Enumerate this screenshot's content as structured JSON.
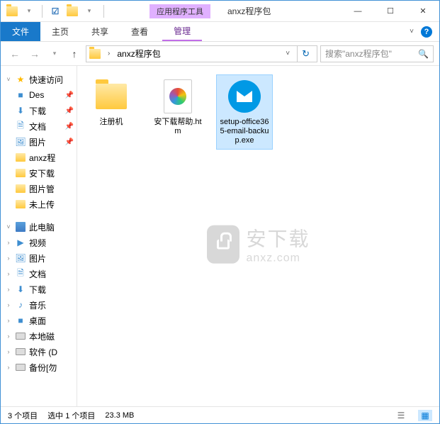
{
  "titlebar": {
    "context_label": "应用程序工具",
    "title": "anxz程序包"
  },
  "window_controls": {
    "min": "—",
    "max": "☐",
    "close": "✕"
  },
  "ribbon": {
    "file": "文件",
    "home": "主页",
    "share": "共享",
    "view": "查看",
    "manage": "管理"
  },
  "nav": {
    "breadcrumb_sep": "›",
    "location": "anxz程序包",
    "search_placeholder": "搜索\"anxz程序包\""
  },
  "tree": {
    "quick_access": "快速访问",
    "desktop": "Des",
    "downloads": "下载",
    "documents": "文档",
    "pictures": "图片",
    "anxz": "anxz程",
    "anxia": "安下载",
    "picmgr": "图片管",
    "notup": "未上传",
    "thispc": "此电脑",
    "videos": "视频",
    "pictures2": "图片",
    "documents2": "文档",
    "downloads2": "下载",
    "music": "音乐",
    "desktop2": "桌面",
    "localdisk": "本地磁",
    "software": "软件 (D",
    "backup": "备份[勿"
  },
  "files": {
    "item1": "注册机",
    "item2": "安下载帮助.htm",
    "item3": "setup-office365-email-backup.exe"
  },
  "watermark": {
    "cn": "安下载",
    "en": "anxz.com"
  },
  "status": {
    "count": "3 个项目",
    "selected": "选中 1 个项目",
    "size": "23.3 MB"
  }
}
